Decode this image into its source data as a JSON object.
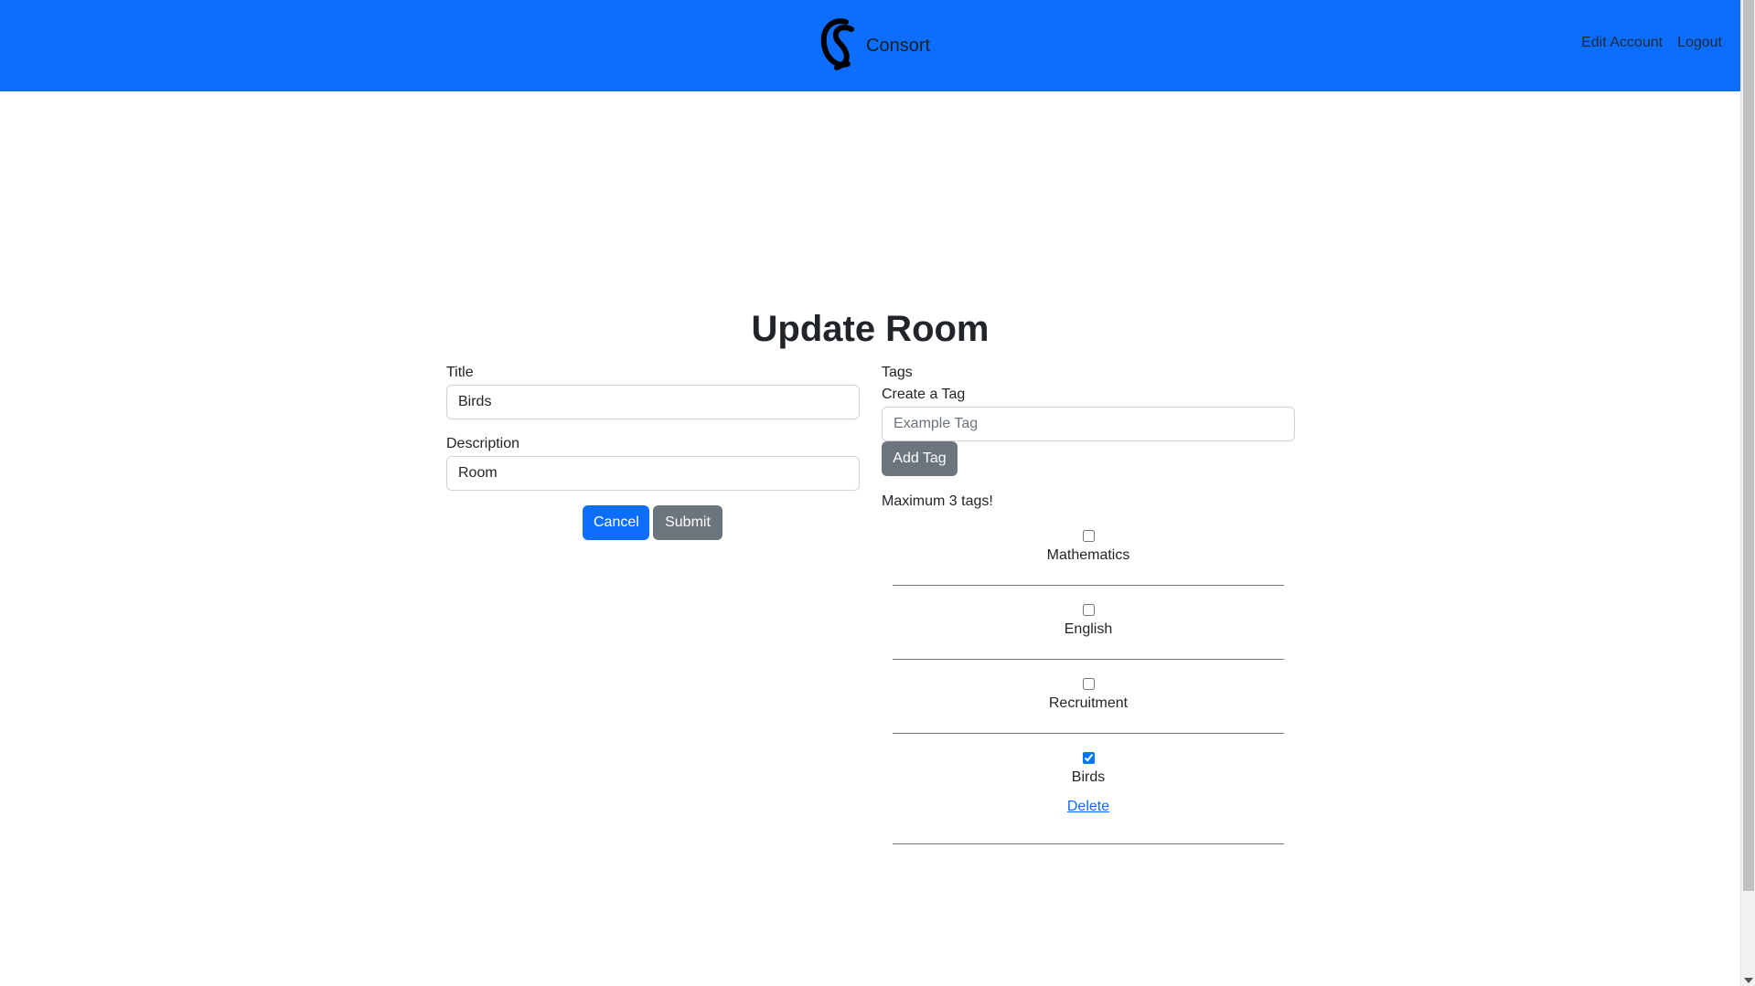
{
  "header": {
    "brand": "Consort",
    "links": {
      "edit_account": "Edit Account",
      "logout": "Logout"
    }
  },
  "page": {
    "title": "Update Room"
  },
  "form": {
    "title_label": "Title",
    "title_value": "Birds",
    "description_label": "Description",
    "description_value": "Room",
    "cancel_label": "Cancel",
    "submit_label": "Submit"
  },
  "tags": {
    "heading": "Tags",
    "create_label": "Create a Tag",
    "create_placeholder": "Example Tag",
    "add_label": "Add Tag",
    "limit_note": "Maximum 3 tags!",
    "items": [
      {
        "label": "Mathematics",
        "checked": false
      },
      {
        "label": "English",
        "checked": false
      },
      {
        "label": "Recruitment",
        "checked": false
      },
      {
        "label": "Birds",
        "checked": true,
        "delete_label": "Delete"
      }
    ]
  },
  "colors": {
    "primary": "#0d6efd",
    "secondary": "#6c757d"
  }
}
